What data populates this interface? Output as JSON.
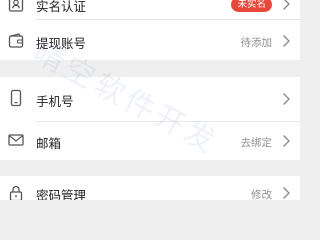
{
  "colors": {
    "background": "#efefef",
    "card": "#ffffff",
    "badge": "#e8483b",
    "text": "#222222",
    "muted": "#8f8f8f",
    "icon": "#555555"
  },
  "rows": {
    "real_name": {
      "label": "实名认证",
      "status": "未实名",
      "icon": "id-card-icon"
    },
    "withdraw_account": {
      "label": "提现账号",
      "status": "待添加",
      "icon": "wallet-icon"
    },
    "phone": {
      "label": "手机号",
      "icon": "phone-icon"
    },
    "email": {
      "label": "邮箱",
      "status": "去绑定",
      "icon": "mail-icon"
    },
    "password": {
      "label": "密码管理",
      "status": "修改",
      "icon": "lock-icon"
    }
  },
  "watermark": "晴空软件开发"
}
